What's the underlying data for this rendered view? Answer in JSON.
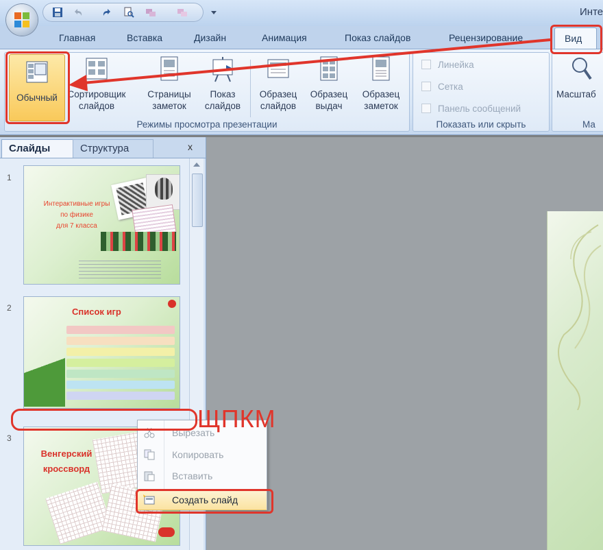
{
  "window": {
    "title": "Инте"
  },
  "tabs": [
    "Главная",
    "Вставка",
    "Дизайн",
    "Анимация",
    "Показ слайдов",
    "Рецензирование",
    "Вид"
  ],
  "ribbon": {
    "views_group": {
      "label": "Режимы просмотра презентации",
      "buttons": [
        {
          "line1": "Обычный",
          "line2": ""
        },
        {
          "line1": "Сортировщик",
          "line2": "слайдов"
        },
        {
          "line1": "Страницы",
          "line2": "заметок"
        },
        {
          "line1": "Показ",
          "line2": "слайдов"
        },
        {
          "line1": "Образец",
          "line2": "слайдов"
        },
        {
          "line1": "Образец",
          "line2": "выдач"
        },
        {
          "line1": "Образец",
          "line2": "заметок"
        }
      ]
    },
    "show_group": {
      "label": "Показать или скрыть",
      "checkboxes": [
        "Линейка",
        "Сетка",
        "Панель сообщений"
      ]
    },
    "zoom_group": {
      "label": "Ма",
      "button": "Масштаб"
    }
  },
  "panel": {
    "tabs": [
      "Слайды",
      "Структура"
    ],
    "close": "x"
  },
  "slides": [
    {
      "number": "1",
      "title_line1": "Интерактивные игры",
      "title_line2": "по физике",
      "title_line3": "для 7 класса"
    },
    {
      "number": "2",
      "title": "Список игр"
    },
    {
      "number": "3",
      "title_line1": "Венгерский",
      "title_line2": "кроссворд"
    }
  ],
  "context_menu": {
    "items": [
      "Вырезать",
      "Копировать",
      "Вставить",
      "Создать слайд"
    ]
  },
  "annotation": {
    "text": "ЩПКМ",
    "color": "#e0352b"
  },
  "colors": {
    "ribbon_bg": "#dfeaf7",
    "highlight": "#e0352b",
    "active_view": "#fbd27c"
  }
}
